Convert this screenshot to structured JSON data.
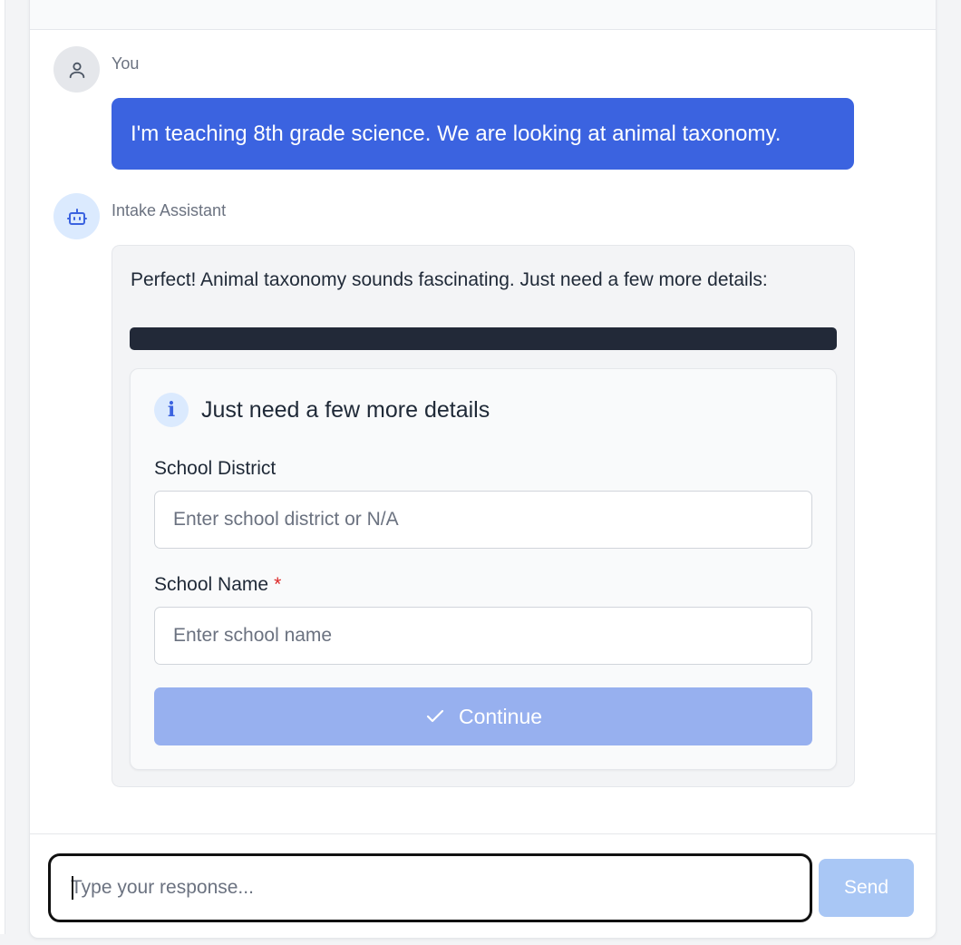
{
  "chat": {
    "messages": [
      {
        "sender": "You",
        "avatar_icon": "user-icon",
        "text": "I'm teaching 8th grade science. We are looking at animal taxonomy."
      },
      {
        "sender": "Intake Assistant",
        "avatar_icon": "bot-icon",
        "text": "Perfect! Animal taxonomy sounds fascinating. Just need a few more details:"
      }
    ],
    "form": {
      "icon": "info-icon",
      "icon_glyph": "i",
      "title": "Just need a few more details",
      "fields": [
        {
          "label": "School District",
          "required": false,
          "placeholder": "Enter school district or N/A",
          "value": ""
        },
        {
          "label": "School Name",
          "required": true,
          "required_mark": "*",
          "placeholder": "Enter school name",
          "value": ""
        }
      ],
      "submit_label": "Continue",
      "submit_icon": "check-icon"
    }
  },
  "composer": {
    "placeholder": "Type your response...",
    "value": "",
    "send_label": "Send"
  },
  "colors": {
    "accent": "#3b63e0",
    "accent_disabled": "#97b0ef",
    "send_disabled": "#a9c7f5",
    "required": "#dc2626",
    "dark_bar": "#222938"
  }
}
